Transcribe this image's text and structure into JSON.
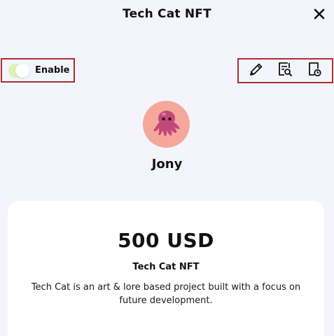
{
  "header": {
    "title": "Tech Cat NFT",
    "close_icon": "close-icon"
  },
  "toggle": {
    "label": "Enable",
    "enabled": true,
    "accent": "#dcf3b4"
  },
  "actions": [
    {
      "icon": "pencil-icon",
      "label": "edit"
    },
    {
      "icon": "document-search-icon",
      "label": "view details"
    },
    {
      "icon": "document-clock-icon",
      "label": "history"
    }
  ],
  "highlight_color": "#a82f36",
  "profile": {
    "name": "Jony",
    "avatar_icon": "octopus-icon",
    "avatar_bg": "#f5a79c"
  },
  "card": {
    "price": "500 USD",
    "nft_name": "Tech Cat NFT",
    "description": "Tech Cat is an art & lore based project built with a focus on future development."
  }
}
